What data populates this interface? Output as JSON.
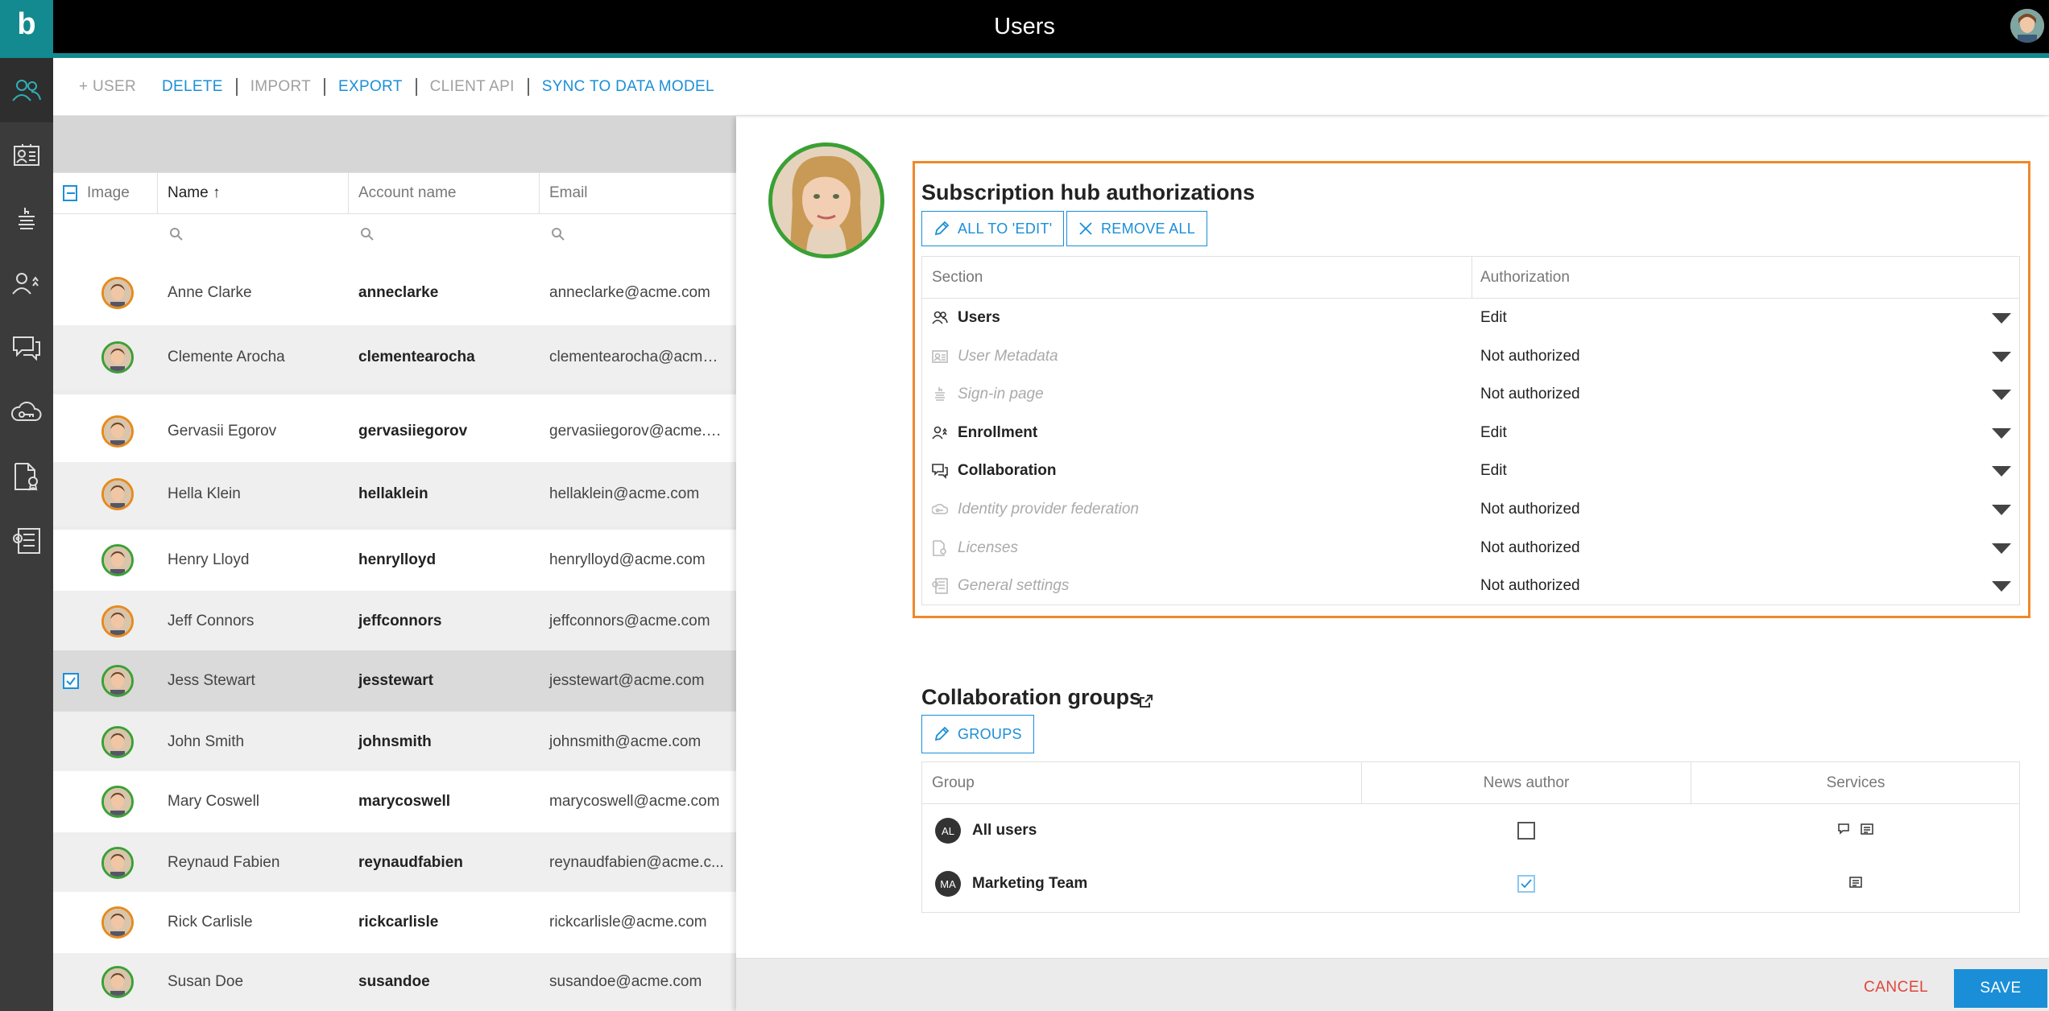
{
  "app": {
    "logo": "b",
    "title": "Users"
  },
  "toolbar": {
    "add_user": "+ USER",
    "delete": "DELETE",
    "import": "IMPORT",
    "export": "EXPORT",
    "client_api": "CLIENT API",
    "sync": "SYNC TO DATA MODEL"
  },
  "sidebar": {
    "items": [
      {
        "icon": "users-icon"
      },
      {
        "icon": "user-metadata-icon"
      },
      {
        "icon": "sign-in-page-icon"
      },
      {
        "icon": "enrollment-icon"
      },
      {
        "icon": "collaboration-icon"
      },
      {
        "icon": "cloud-key-icon"
      },
      {
        "icon": "license-icon"
      },
      {
        "icon": "settings-icon"
      }
    ]
  },
  "table": {
    "columns": {
      "image": "Image",
      "name": "Name ↑",
      "account": "Account name",
      "email": "Email"
    },
    "rows": [
      {
        "name": "Anne Clarke",
        "account": "anneclarke",
        "email": "anneclarke@acme.com",
        "ring": "#e58a1d",
        "checked": false
      },
      {
        "name": "Clemente Arocha",
        "account": "clementearocha",
        "email": "clementearocha@acme....",
        "ring": "#3aa035",
        "checked": false
      },
      {
        "name": "Gervasii Egorov",
        "account": "gervasiiegorov",
        "email": "gervasiiegorov@acme.c...",
        "ring": "#e58a1d",
        "checked": false
      },
      {
        "name": "Hella Klein",
        "account": "hellaklein",
        "email": "hellaklein@acme.com",
        "ring": "#e58a1d",
        "checked": false
      },
      {
        "name": "Henry Lloyd",
        "account": "henrylloyd",
        "email": "henrylloyd@acme.com",
        "ring": "#3aa035",
        "checked": false
      },
      {
        "name": "Jeff Connors",
        "account": "jeffconnors",
        "email": "jeffconnors@acme.com",
        "ring": "#e58a1d",
        "checked": false
      },
      {
        "name": "Jess Stewart",
        "account": "jesstewart",
        "email": "jesstewart@acme.com",
        "ring": "#3aa035",
        "checked": true
      },
      {
        "name": "John Smith",
        "account": "johnsmith",
        "email": "johnsmith@acme.com",
        "ring": "#3aa035",
        "checked": false
      },
      {
        "name": "Mary Coswell",
        "account": "marycoswell",
        "email": "marycoswell@acme.com",
        "ring": "#3aa035",
        "checked": false
      },
      {
        "name": "Reynaud Fabien",
        "account": "reynaudfabien",
        "email": "reynaudfabien@acme.c...",
        "ring": "#3aa035",
        "checked": false
      },
      {
        "name": "Rick Carlisle",
        "account": "rickcarlisle",
        "email": "rickcarlisle@acme.com",
        "ring": "#e58a1d",
        "checked": false
      },
      {
        "name": "Susan Doe",
        "account": "susandoe",
        "email": "susandoe@acme.com",
        "ring": "#3aa035",
        "checked": false
      }
    ]
  },
  "auth": {
    "title": "Subscription hub authorizations",
    "all_to_edit": "ALL TO 'EDIT'",
    "remove_all": "REMOVE ALL",
    "columns": {
      "section": "Section",
      "authorization": "Authorization"
    },
    "rows": [
      {
        "section": "Users",
        "value": "Edit",
        "enabled": true,
        "icon": "users-icon"
      },
      {
        "section": "User Metadata",
        "value": "Not authorized",
        "enabled": false,
        "icon": "user-metadata-icon"
      },
      {
        "section": "Sign-in page",
        "value": "Not authorized",
        "enabled": false,
        "icon": "sign-in-page-icon"
      },
      {
        "section": "Enrollment",
        "value": "Edit",
        "enabled": true,
        "icon": "enrollment-icon"
      },
      {
        "section": "Collaboration",
        "value": "Edit",
        "enabled": true,
        "icon": "collaboration-icon"
      },
      {
        "section": "Identity provider federation",
        "value": "Not authorized",
        "enabled": false,
        "icon": "cloud-key-icon"
      },
      {
        "section": "Licenses",
        "value": "Not authorized",
        "enabled": false,
        "icon": "license-icon"
      },
      {
        "section": "General settings",
        "value": "Not authorized",
        "enabled": false,
        "icon": "settings-icon"
      }
    ]
  },
  "groups": {
    "title": "Collaboration groups",
    "groups_button": "GROUPS",
    "columns": {
      "group": "Group",
      "news_author": "News author",
      "services": "Services"
    },
    "rows": [
      {
        "initials": "AL",
        "name": "All users",
        "news_author": false,
        "services": [
          "chat-icon",
          "news-icon"
        ]
      },
      {
        "initials": "MA",
        "name": "Marketing Team",
        "news_author": true,
        "services": [
          "news-icon"
        ]
      }
    ]
  },
  "footer": {
    "cancel": "CANCEL",
    "save": "SAVE"
  },
  "colors": {
    "accent": "#1a8fd8",
    "brand": "#128a8f",
    "highlight": "#f0882a",
    "cancel": "#e0453b"
  }
}
